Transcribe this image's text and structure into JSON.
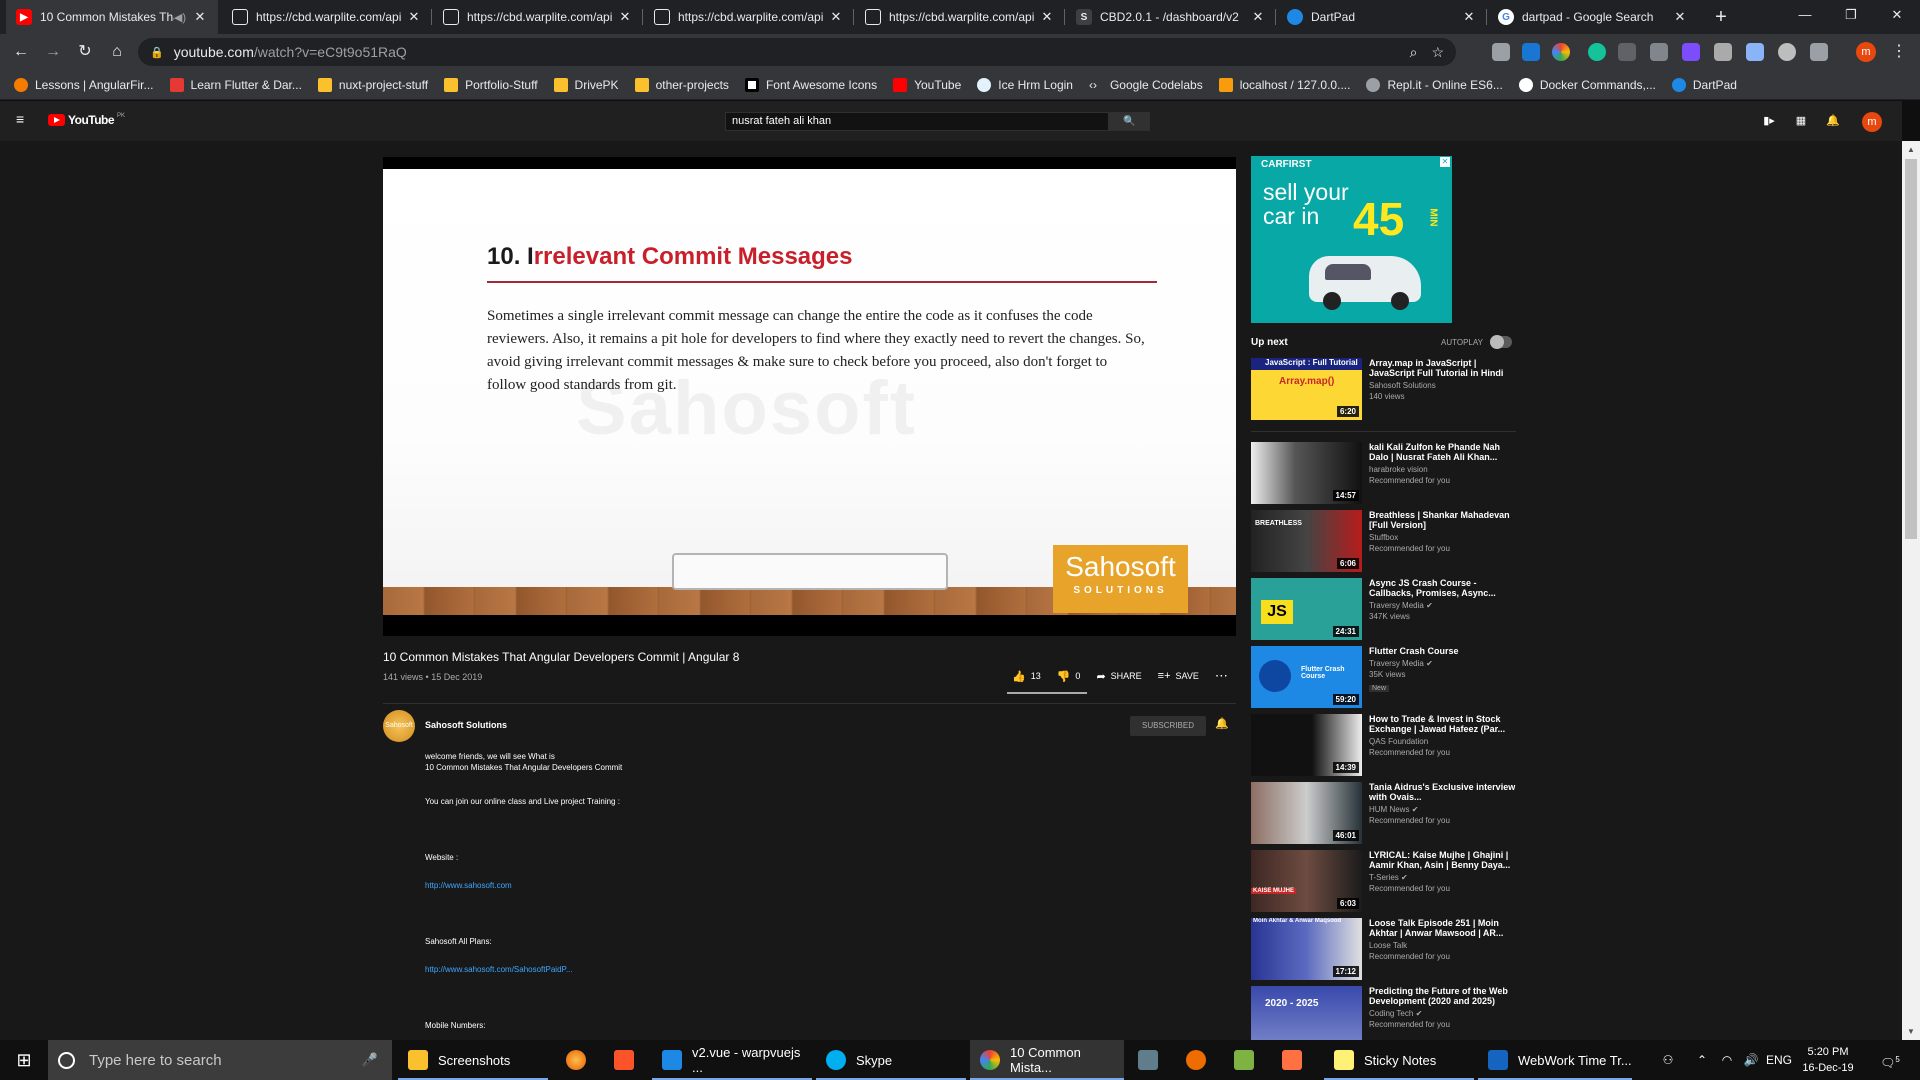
{
  "browser": {
    "tabs": [
      {
        "title": "10 Common Mistakes That Angular Developers Commit | Angular 8",
        "favicon": "youtube-icon",
        "active": true
      },
      {
        "title": "https://cbd.warplite.com/api",
        "favicon": "page-icon"
      },
      {
        "title": "https://cbd.warplite.com/api",
        "favicon": "page-icon"
      },
      {
        "title": "https://cbd.warplite.com/api",
        "favicon": "page-icon"
      },
      {
        "title": "https://cbd.warplite.com/api",
        "favicon": "page-icon"
      },
      {
        "title": "CBD2.0.1 - /dashboard/v2",
        "favicon": "s-icon"
      },
      {
        "title": "DartPad",
        "favicon": "dart-icon"
      },
      {
        "title": "dartpad - Google Search",
        "favicon": "google-icon"
      }
    ],
    "url_host": "youtube.com",
    "url_path": "/watch?v=eC9t9o51RaQ",
    "profile_initial": "m",
    "bookmarks": [
      "Lessons | AngularFir...",
      "Learn Flutter & Dar...",
      "nuxt-project-stuff",
      "Portfolio-Stuff",
      "DrivePK",
      "other-projects",
      "Font Awesome Icons",
      "YouTube",
      "Ice Hrm Login",
      "Google Codelabs",
      "localhost / 127.0.0....",
      "Repl.it - Online ES6...",
      "Docker Commands,...",
      "DartPad"
    ]
  },
  "youtube": {
    "logo_text": "YouTube",
    "logo_region": "PK",
    "search_value": "nusrat fateh ali khan",
    "profile_initial": "m",
    "slide": {
      "title_first": "10. I",
      "title_rest": "rrelevant Commit Messages",
      "body": "Sometimes a single irrelevant commit message can change the entire the code as it confuses the code reviewers. Also, it remains a pit hole for developers to find where they exactly need to revert the changes. So, avoid giving irrelevant commit messages & make sure to check before you proceed, also don't forget to follow good standards from git.",
      "watermark": "Sahosoft",
      "logo_line1": "Sahosoft",
      "logo_line2": "SOLUTIONS"
    },
    "video": {
      "title": "10 Common Mistakes That Angular Developers Commit | Angular 8",
      "views": "141 views",
      "date": "15 Dec 2019",
      "likes": "13",
      "dislikes": "0",
      "likes_ratio": 1.0,
      "share_label": "SHARE",
      "save_label": "SAVE",
      "channel": "Sahosoft Solutions",
      "subscribe_label": "SUBSCRIBED"
    },
    "description": {
      "line1": "welcome friends, we will see  What is",
      "line2": "10 Common Mistakes That Angular Developers Commit",
      "line3": "You can join our online class and Live project Training :",
      "line4": "Website :",
      "link1": "http://www.sahosoft.com",
      "line5": "Sahosoft All Plans:",
      "link2": "http://www.sahosoft.com/SahosoftPaidP...",
      "line6": "Mobile Numbers:"
    },
    "ad": {
      "brand": "CARFIRST",
      "line1": "sell your",
      "line2": "car in",
      "big": "45",
      "unit": "MIN"
    },
    "sidebar": {
      "up_next": "Up next",
      "autoplay": "AUTOPLAY",
      "items": [
        {
          "title": "Array.map in JavaScript | JavaScript Full Tutorial in Hindi",
          "channel": "Sahosoft Solutions",
          "meta": "140 views",
          "duration": "6:20",
          "thumb_text": "JavaScript : Full Tutorial"
        },
        {
          "title": "kali Kali Zulfon ke Phande Nah Dalo | Nusrat Fateh Ali Khan...",
          "channel": "harabroke vision",
          "meta": "Recommended for you",
          "duration": "14:57"
        },
        {
          "title": "Breathless | Shankar Mahadevan [Full Version]",
          "channel": "Stuffbox",
          "meta": "Recommended for you",
          "duration": "6:06",
          "thumb_text": "BREATHLESS"
        },
        {
          "title": "Async JS Crash Course - Callbacks, Promises, Async...",
          "channel": "Traversy Media",
          "meta": "347K views",
          "duration": "24:31",
          "thumb_text": "JS"
        },
        {
          "title": "Flutter Crash Course",
          "channel": "Traversy Media",
          "meta": "35K views",
          "badge": "New",
          "duration": "59:20",
          "thumb_text": "Flutter Crash Course"
        },
        {
          "title": "How to Trade & Invest in Stock Exchange | Jawad Hafeez (Par...",
          "channel": "QAS Foundation",
          "meta": "Recommended for you",
          "duration": "14:39"
        },
        {
          "title": "Tania Aidrus's Exclusive interview with Ovais...",
          "channel": "HUM News",
          "meta": "Recommended for you",
          "duration": "46:01"
        },
        {
          "title": "LYRICAL: Kaise Mujhe | Ghajini | Aamir Khan, Asin | Benny Daya...",
          "channel": "T-Series",
          "meta": "Recommended for you",
          "duration": "6:03",
          "thumb_text": "KAISE MUJHE"
        },
        {
          "title": "Loose Talk Episode 251 | Moin Akhtar | Anwar Mawsood | AR...",
          "channel": "Loose Talk",
          "meta": "Recommended for you",
          "duration": "17:12",
          "thumb_text": "Moin Akhtar & Anwar Maqsood"
        },
        {
          "title": "Predicting the Future of the Web Development (2020 and 2025)",
          "channel": "Coding Tech",
          "meta": "Recommended for you",
          "duration": "",
          "thumb_text": "2020 - 2025"
        }
      ]
    }
  },
  "taskbar": {
    "search_placeholder": "Type here to search",
    "items": [
      {
        "label": "Screenshots",
        "icon": "folder-icon"
      },
      {
        "label": "",
        "icon": "firefox-icon"
      },
      {
        "label": "",
        "icon": "brave-icon"
      },
      {
        "label": "v2.vue - warpvuejs ...",
        "icon": "vscode-icon"
      },
      {
        "label": "Skype",
        "icon": "skype-icon"
      },
      {
        "label": "10 Common Mista...",
        "icon": "chrome-icon"
      },
      {
        "label": "",
        "icon": "network-icon"
      },
      {
        "label": "",
        "icon": "postman-icon"
      },
      {
        "label": "",
        "icon": "terminal-icon"
      },
      {
        "label": "",
        "icon": "app-icon"
      },
      {
        "label": "Sticky Notes",
        "icon": "sticky-notes-icon"
      },
      {
        "label": "WebWork Time Tr...",
        "icon": "webwork-icon"
      }
    ],
    "lang": "ENG",
    "time": "5:20 PM",
    "date": "16-Dec-19",
    "notifications": "5"
  },
  "colors": {
    "yt_red": "#ff0000",
    "accent_blue": "#3ea6ff",
    "slide_title_red": "#c8202a",
    "logo_orange": "#e8a32a"
  }
}
